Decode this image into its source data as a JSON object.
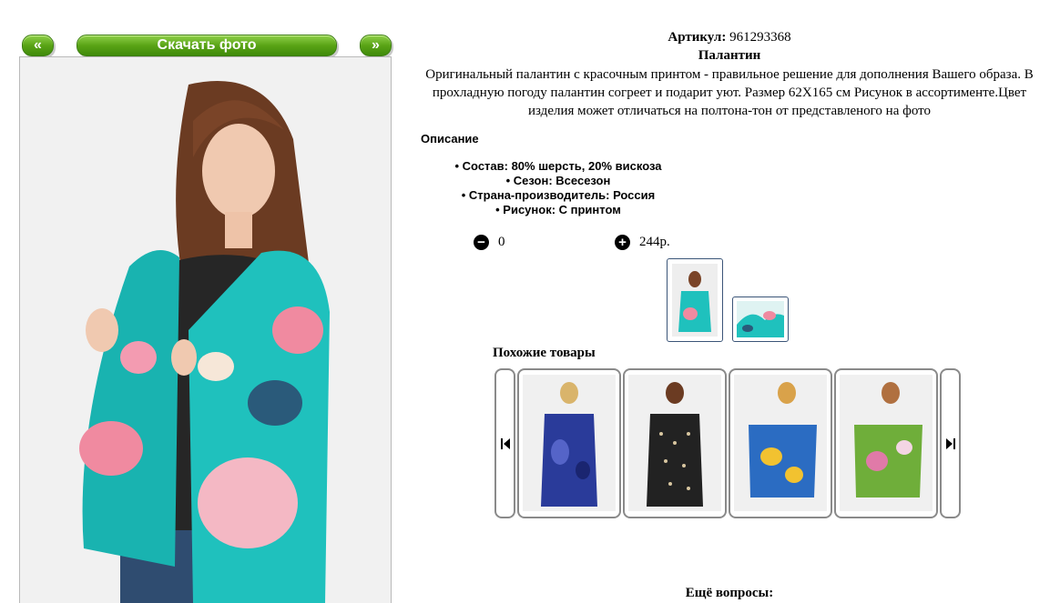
{
  "nav": {
    "prev_label": "«",
    "download_label": "Скачать фото",
    "next_label": "»"
  },
  "product": {
    "article_label": "Артикул:",
    "article_value": "961293368",
    "name": "Палантин",
    "description_line1": "Оригинальный палантин с красочным принтом - правильное решение для дополнения Вашего образа. В",
    "description_line2": "прохладную погоду палантин согреет и подарит уют. Размер 62Х165 см Рисунок в ассортименте.Цвет",
    "description_line3": "изделия может отличаться на полтона-тон от представленого на фото"
  },
  "details": {
    "title": "Описание",
    "specs": [
      "Состав: 80% шерсть, 20% вискоза",
      "Сезон: Всесезон",
      "Страна-производитель: Россия",
      "Рисунок: С принтом"
    ]
  },
  "cart": {
    "quantity": "0",
    "price": "244р.",
    "minus_icon": "minus-circle-icon",
    "plus_icon": "plus-circle-icon"
  },
  "similar": {
    "title": "Похожие товары",
    "items": [
      {
        "name": "paisley-scarf-blue",
        "color": "#2a3b9a"
      },
      {
        "name": "dotted-scarf-black",
        "color": "#222222"
      },
      {
        "name": "floral-scarf-blue-yellow",
        "color": "#2b6cc2"
      },
      {
        "name": "floral-scarf-green-pink",
        "color": "#6fae3a"
      }
    ]
  },
  "footer": {
    "cut_text": "Ещё вопросы:"
  },
  "colors": {
    "button_green": "#5aa416",
    "thumb_border": "#3b5578",
    "carousel_border": "#8a8a8a"
  }
}
